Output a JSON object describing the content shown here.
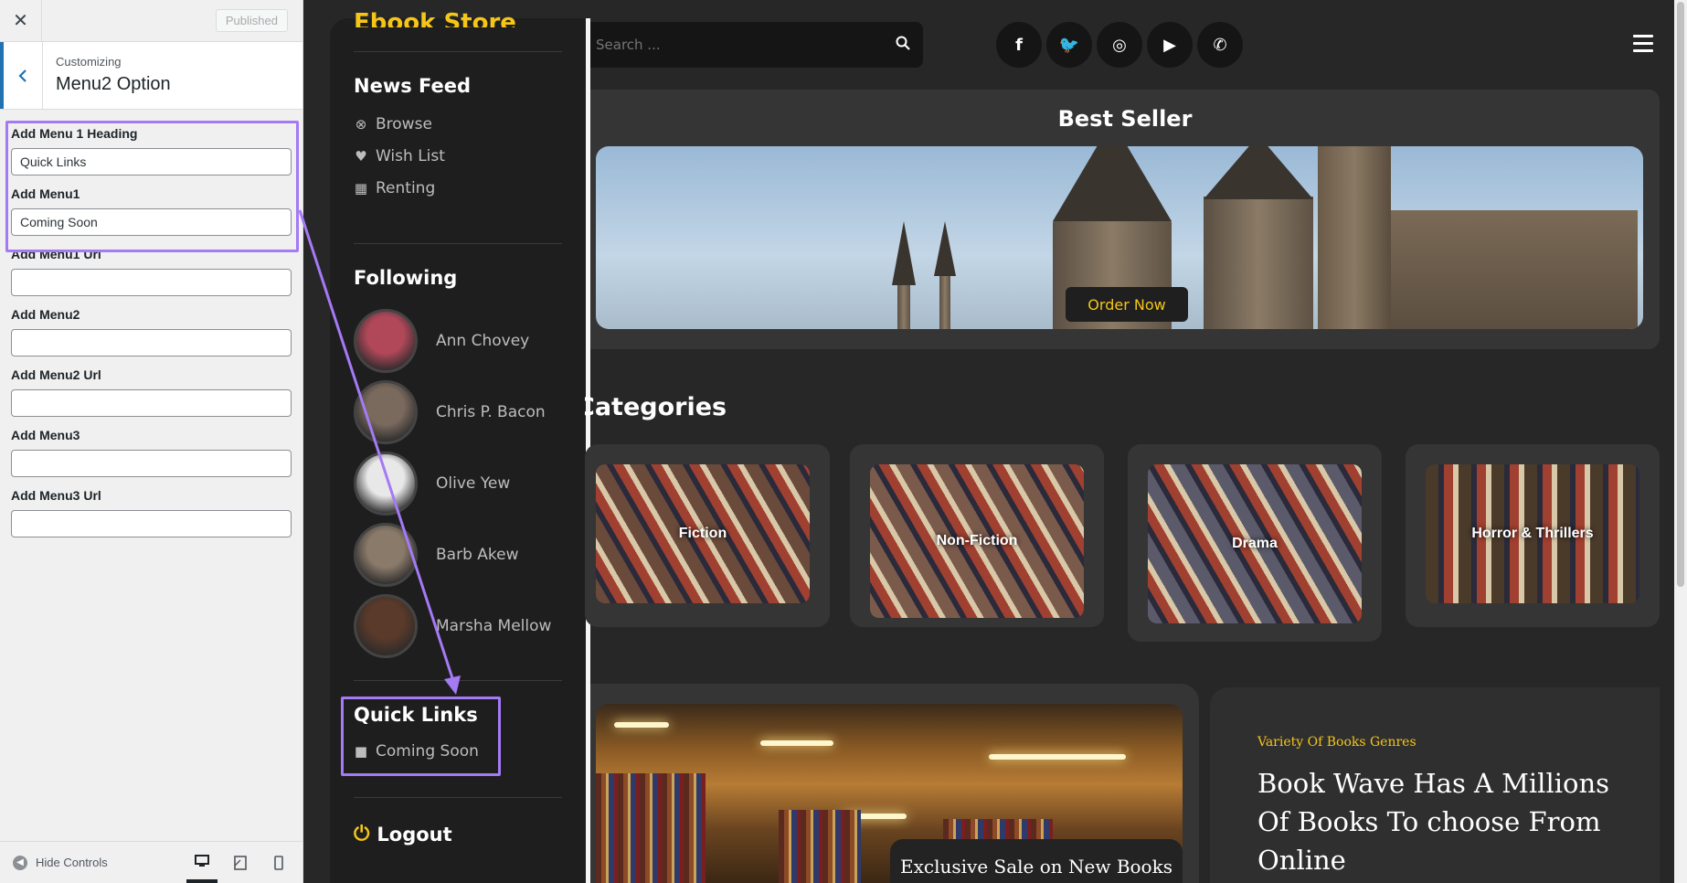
{
  "customizer": {
    "close_icon": "✕",
    "published_label": "Published",
    "back_icon": "chevron-left",
    "breadcrumb": "Customizing",
    "section_title": "Menu2 Option",
    "fields": [
      {
        "label": "Add Menu 1 Heading",
        "value": "Quick Links"
      },
      {
        "label": "Add Menu1",
        "value": "Coming Soon"
      },
      {
        "label": "Add Menu1 Url",
        "value": ""
      },
      {
        "label": "Add Menu2",
        "value": ""
      },
      {
        "label": "Add Menu2 Url",
        "value": ""
      },
      {
        "label": "Add Menu3",
        "value": ""
      },
      {
        "label": "Add Menu3 Url",
        "value": ""
      }
    ],
    "hide_controls_label": "Hide Controls"
  },
  "sidebar": {
    "brand": "Ebook Store",
    "news_feed_heading": "News Feed",
    "news_items": [
      {
        "icon": "⊗",
        "label": "Browse"
      },
      {
        "icon": "♥",
        "label": "Wish List"
      },
      {
        "icon": "▦",
        "label": "Renting"
      }
    ],
    "following_heading": "Following",
    "following": [
      {
        "name": "Ann Chovey",
        "color": "#b0485a"
      },
      {
        "name": "Chris P. Bacon",
        "color": "#7a6a5e"
      },
      {
        "name": "Olive Yew",
        "color": "#e8e8e8"
      },
      {
        "name": "Barb Akew",
        "color": "#8a7a6a"
      },
      {
        "name": "Marsha Mellow",
        "color": "#5a3a2a"
      }
    ],
    "quick_links_heading": "Quick Links",
    "quick_links_item": "Coming Soon",
    "quick_links_icon": "■",
    "logout_label": "Logout",
    "logout_icon": "⏻"
  },
  "header": {
    "search_placeholder": "Search ...",
    "search_icon": "⚲",
    "socials": [
      {
        "name": "facebook-icon",
        "glyph": "f"
      },
      {
        "name": "twitter-icon",
        "glyph": "🐦"
      },
      {
        "name": "instagram-icon",
        "glyph": "◎"
      },
      {
        "name": "youtube-icon",
        "glyph": "▶"
      },
      {
        "name": "whatsapp-icon",
        "glyph": "✆"
      }
    ]
  },
  "best_seller": {
    "title": "Best Seller",
    "button_label": "Order Now"
  },
  "categories": {
    "heading": "Categories",
    "items": [
      {
        "label": "Fiction",
        "color": "#6a4a3a"
      },
      {
        "label": "Non-Fiction",
        "color": "#7a5a4a"
      },
      {
        "label": "Drama",
        "color": "#5a5a6a"
      },
      {
        "label": "Horror & Thrillers",
        "color": "#4a3a2a"
      }
    ]
  },
  "promo": {
    "sale_label": "Exclusive Sale on New Books",
    "tagline": "Variety Of Books Genres",
    "headline": "Book Wave Has A Millions Of Books To choose From Online"
  },
  "colors": {
    "accent": "#f5c518",
    "highlight": "#a47af5",
    "wp_blue": "#2271b1"
  }
}
